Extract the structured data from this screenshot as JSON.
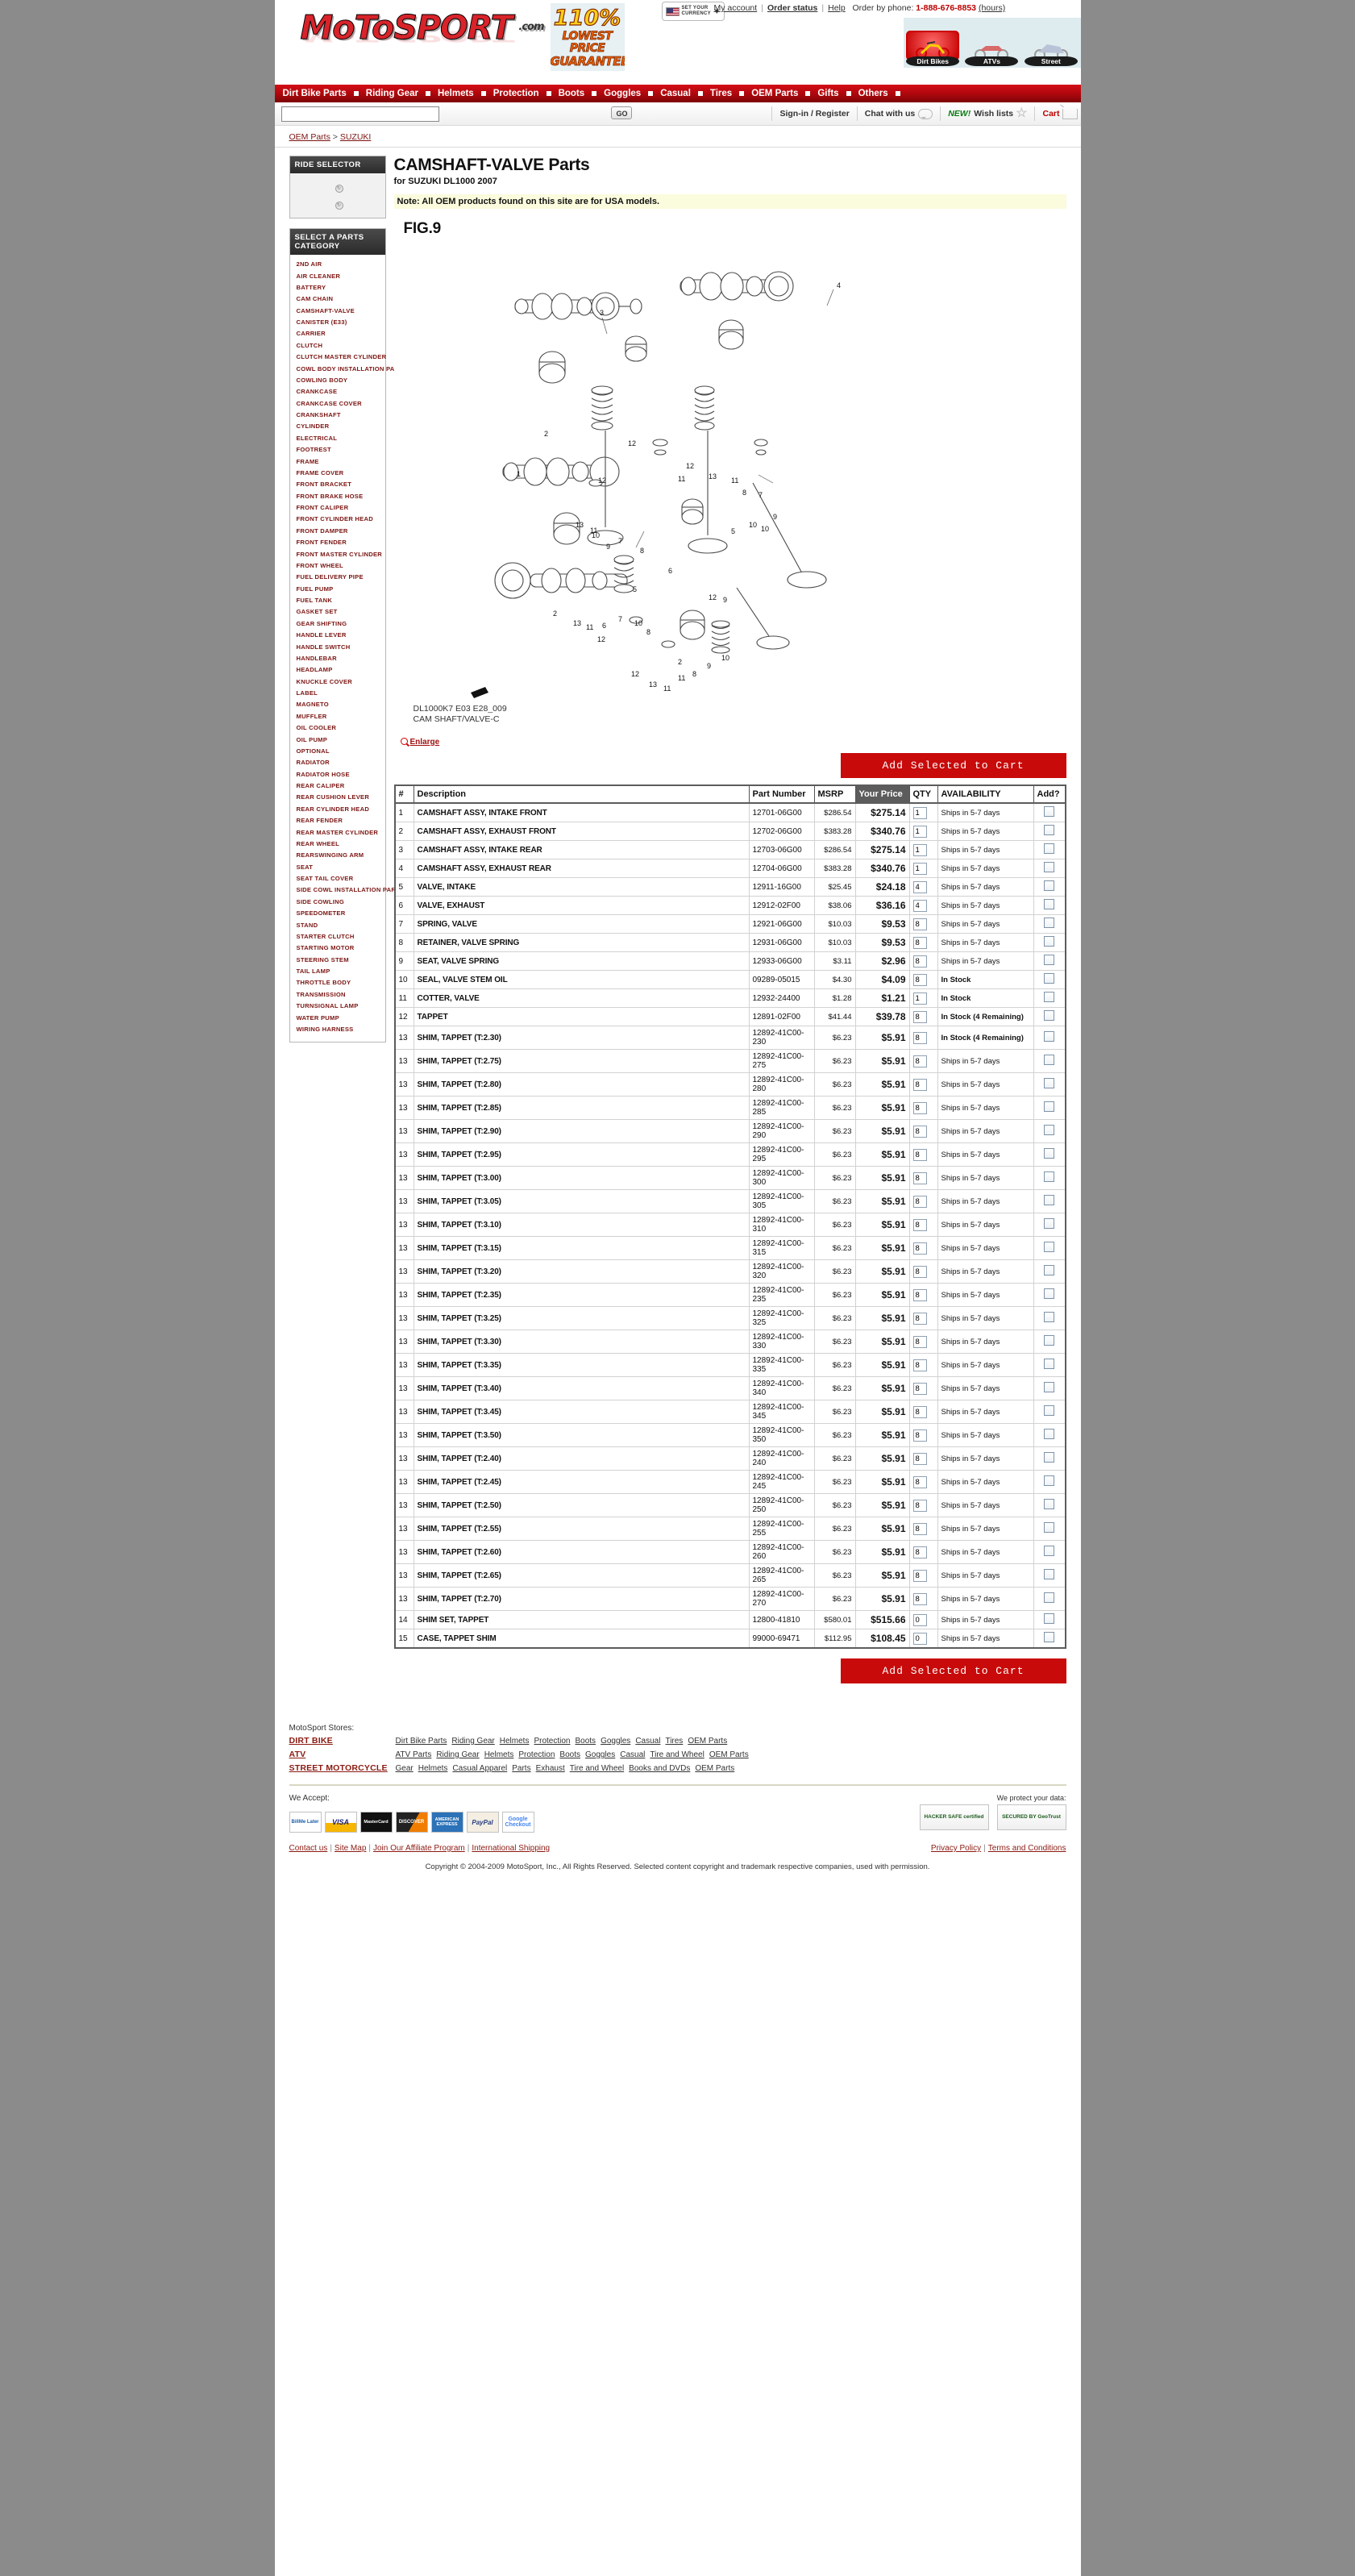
{
  "header": {
    "logo_text": "MoToSPORT",
    "logo_suffix": ".com",
    "guarantee_pct": "110%",
    "guarantee_line2": "LOWEST PRICE",
    "guarantee_line3": "GUARANTEE",
    "currency_line1": "SET YOUR",
    "currency_line2": "CURRENCY",
    "my_account": "My account",
    "order_status": "Order status",
    "help": "Help",
    "order_by_phone_label": "Order by phone:",
    "phone": "1-888-676-8853",
    "hours": "(hours)",
    "ride_tabs": [
      {
        "label": "Dirt Bikes",
        "selected": true
      },
      {
        "label": "ATVs",
        "selected": false
      },
      {
        "label": "Street",
        "selected": false
      }
    ]
  },
  "nav": {
    "items": [
      "Dirt Bike Parts",
      "Riding Gear",
      "Helmets",
      "Protection",
      "Boots",
      "Goggles",
      "Casual",
      "Tires",
      "OEM Parts",
      "Gifts",
      "Others"
    ]
  },
  "search": {
    "value": "",
    "placeholder": "",
    "go_label": "GO",
    "sign_in": "Sign-in / Register",
    "chat": "Chat with us",
    "new_tag": "NEW!",
    "wish_lists": "Wish lists",
    "cart": "Cart"
  },
  "breadcrumb": {
    "root": "OEM Parts",
    "separator": ">",
    "current": "SUZUKI"
  },
  "sidebar": {
    "ride_selector_title": "RIDE SELECTOR",
    "categories_title": "SELECT A PARTS CATEGORY",
    "categories": [
      "2ND AIR",
      "AIR CLEANER",
      "BATTERY",
      "CAM CHAIN",
      "CAMSHAFT-VALVE",
      "CANISTER (E33)",
      "CARRIER",
      "CLUTCH",
      "CLUTCH MASTER CYLINDER",
      "COWL BODY INSTALLATION PARTS",
      "COWLING BODY",
      "CRANKCASE",
      "CRANKCASE COVER",
      "CRANKSHAFT",
      "CYLINDER",
      "ELECTRICAL",
      "FOOTREST",
      "FRAME",
      "FRAME COVER",
      "FRONT BRACKET",
      "FRONT BRAKE HOSE",
      "FRONT CALIPER",
      "FRONT CYLINDER HEAD",
      "FRONT DAMPER",
      "FRONT FENDER",
      "FRONT MASTER CYLINDER",
      "FRONT WHEEL",
      "FUEL DELIVERY PIPE",
      "FUEL PUMP",
      "FUEL TANK",
      "GASKET SET",
      "GEAR SHIFTING",
      "HANDLE LEVER",
      "HANDLE SWITCH",
      "HANDLEBAR",
      "HEADLAMP",
      "KNUCKLE COVER",
      "LABEL",
      "MAGNETO",
      "MUFFLER",
      "OIL COOLER",
      "OIL PUMP",
      "OPTIONAL",
      "RADIATOR",
      "RADIATOR HOSE",
      "REAR CALIPER",
      "REAR CUSHION LEVER",
      "REAR CYLINDER HEAD",
      "REAR FENDER",
      "REAR MASTER CYLINDER",
      "REAR WHEEL",
      "REARSWINGING ARM",
      "SEAT",
      "SEAT TAIL COVER",
      "SIDE COWL INSTALLATION PARTS",
      "SIDE COWLING",
      "SPEEDOMETER",
      "STAND",
      "STARTER CLUTCH",
      "STARTING MOTOR",
      "STEERING STEM",
      "TAIL LAMP",
      "THROTTLE BODY",
      "TRANSMISSION",
      "TURNSIGNAL LAMP",
      "WATER PUMP",
      "WIRING HARNESS"
    ]
  },
  "main": {
    "title": "CAMSHAFT-VALVE Parts",
    "subtitle": "for SUZUKI DL1000 2007",
    "note": "Note: All OEM products found on this site are for USA models.",
    "fig_label": "FIG.9",
    "diagram_caption_line1": "DL1000K7 E03 E28_009",
    "diagram_caption_line2": "CAM SHAFT/VALVE-C",
    "enlarge": "Enlarge",
    "add_to_cart_top": "Add Selected to Cart",
    "add_to_cart_bottom": "Add Selected to Cart"
  },
  "table": {
    "headers": [
      "#",
      "Description",
      "Part Number",
      "MSRP",
      "Your Price",
      "QTY",
      "AVAILABILITY",
      "Add?"
    ],
    "rows": [
      {
        "n": "1",
        "desc": "CAMSHAFT ASSY, INTAKE FRONT",
        "pn": "12701-06G00",
        "msrp": "$286.54",
        "price": "$275.14",
        "qty": "1",
        "avail": "Ships in 5-7 days",
        "instock": false
      },
      {
        "n": "2",
        "desc": "CAMSHAFT ASSY, EXHAUST FRONT",
        "pn": "12702-06G00",
        "msrp": "$383.28",
        "price": "$340.76",
        "qty": "1",
        "avail": "Ships in 5-7 days",
        "instock": false
      },
      {
        "n": "3",
        "desc": "CAMSHAFT ASSY, INTAKE REAR",
        "pn": "12703-06G00",
        "msrp": "$286.54",
        "price": "$275.14",
        "qty": "1",
        "avail": "Ships in 5-7 days",
        "instock": false
      },
      {
        "n": "4",
        "desc": "CAMSHAFT ASSY, EXHAUST REAR",
        "pn": "12704-06G00",
        "msrp": "$383.28",
        "price": "$340.76",
        "qty": "1",
        "avail": "Ships in 5-7 days",
        "instock": false
      },
      {
        "n": "5",
        "desc": "VALVE, INTAKE",
        "pn": "12911-16G00",
        "msrp": "$25.45",
        "price": "$24.18",
        "qty": "4",
        "avail": "Ships in 5-7 days",
        "instock": false
      },
      {
        "n": "6",
        "desc": "VALVE, EXHAUST",
        "pn": "12912-02F00",
        "msrp": "$38.06",
        "price": "$36.16",
        "qty": "4",
        "avail": "Ships in 5-7 days",
        "instock": false
      },
      {
        "n": "7",
        "desc": "SPRING, VALVE",
        "pn": "12921-06G00",
        "msrp": "$10.03",
        "price": "$9.53",
        "qty": "8",
        "avail": "Ships in 5-7 days",
        "instock": false
      },
      {
        "n": "8",
        "desc": "RETAINER, VALVE SPRING",
        "pn": "12931-06G00",
        "msrp": "$10.03",
        "price": "$9.53",
        "qty": "8",
        "avail": "Ships in 5-7 days",
        "instock": false
      },
      {
        "n": "9",
        "desc": "SEAT, VALVE SPRING",
        "pn": "12933-06G00",
        "msrp": "$3.11",
        "price": "$2.96",
        "qty": "8",
        "avail": "Ships in 5-7 days",
        "instock": false
      },
      {
        "n": "10",
        "desc": "SEAL, VALVE STEM OIL",
        "pn": "09289-05015",
        "msrp": "$4.30",
        "price": "$4.09",
        "qty": "8",
        "avail": "In Stock",
        "instock": true
      },
      {
        "n": "11",
        "desc": "COTTER, VALVE",
        "pn": "12932-24400",
        "msrp": "$1.28",
        "price": "$1.21",
        "qty": "1",
        "avail": "In Stock",
        "instock": true
      },
      {
        "n": "12",
        "desc": "TAPPET",
        "pn": "12891-02F00",
        "msrp": "$41.44",
        "price": "$39.78",
        "qty": "8",
        "avail": "In Stock (4 Remaining)",
        "instock": true
      },
      {
        "n": "13",
        "desc": "SHIM, TAPPET (T:2.30)",
        "pn": "12892-41C00-230",
        "msrp": "$6.23",
        "price": "$5.91",
        "qty": "8",
        "avail": "In Stock (4 Remaining)",
        "instock": true
      },
      {
        "n": "13",
        "desc": "SHIM, TAPPET (T:2.75)",
        "pn": "12892-41C00-275",
        "msrp": "$6.23",
        "price": "$5.91",
        "qty": "8",
        "avail": "Ships in 5-7 days",
        "instock": false
      },
      {
        "n": "13",
        "desc": "SHIM, TAPPET (T:2.80)",
        "pn": "12892-41C00-280",
        "msrp": "$6.23",
        "price": "$5.91",
        "qty": "8",
        "avail": "Ships in 5-7 days",
        "instock": false
      },
      {
        "n": "13",
        "desc": "SHIM, TAPPET (T:2.85)",
        "pn": "12892-41C00-285",
        "msrp": "$6.23",
        "price": "$5.91",
        "qty": "8",
        "avail": "Ships in 5-7 days",
        "instock": false
      },
      {
        "n": "13",
        "desc": "SHIM, TAPPET (T:2.90)",
        "pn": "12892-41C00-290",
        "msrp": "$6.23",
        "price": "$5.91",
        "qty": "8",
        "avail": "Ships in 5-7 days",
        "instock": false
      },
      {
        "n": "13",
        "desc": "SHIM, TAPPET (T:2.95)",
        "pn": "12892-41C00-295",
        "msrp": "$6.23",
        "price": "$5.91",
        "qty": "8",
        "avail": "Ships in 5-7 days",
        "instock": false
      },
      {
        "n": "13",
        "desc": "SHIM, TAPPET (T:3.00)",
        "pn": "12892-41C00-300",
        "msrp": "$6.23",
        "price": "$5.91",
        "qty": "8",
        "avail": "Ships in 5-7 days",
        "instock": false
      },
      {
        "n": "13",
        "desc": "SHIM, TAPPET (T:3.05)",
        "pn": "12892-41C00-305",
        "msrp": "$6.23",
        "price": "$5.91",
        "qty": "8",
        "avail": "Ships in 5-7 days",
        "instock": false
      },
      {
        "n": "13",
        "desc": "SHIM, TAPPET (T:3.10)",
        "pn": "12892-41C00-310",
        "msrp": "$6.23",
        "price": "$5.91",
        "qty": "8",
        "avail": "Ships in 5-7 days",
        "instock": false
      },
      {
        "n": "13",
        "desc": "SHIM, TAPPET (T:3.15)",
        "pn": "12892-41C00-315",
        "msrp": "$6.23",
        "price": "$5.91",
        "qty": "8",
        "avail": "Ships in 5-7 days",
        "instock": false
      },
      {
        "n": "13",
        "desc": "SHIM, TAPPET (T:3.20)",
        "pn": "12892-41C00-320",
        "msrp": "$6.23",
        "price": "$5.91",
        "qty": "8",
        "avail": "Ships in 5-7 days",
        "instock": false
      },
      {
        "n": "13",
        "desc": "SHIM, TAPPET (T:2.35)",
        "pn": "12892-41C00-235",
        "msrp": "$6.23",
        "price": "$5.91",
        "qty": "8",
        "avail": "Ships in 5-7 days",
        "instock": false
      },
      {
        "n": "13",
        "desc": "SHIM, TAPPET (T:3.25)",
        "pn": "12892-41C00-325",
        "msrp": "$6.23",
        "price": "$5.91",
        "qty": "8",
        "avail": "Ships in 5-7 days",
        "instock": false
      },
      {
        "n": "13",
        "desc": "SHIM, TAPPET (T:3.30)",
        "pn": "12892-41C00-330",
        "msrp": "$6.23",
        "price": "$5.91",
        "qty": "8",
        "avail": "Ships in 5-7 days",
        "instock": false
      },
      {
        "n": "13",
        "desc": "SHIM, TAPPET (T:3.35)",
        "pn": "12892-41C00-335",
        "msrp": "$6.23",
        "price": "$5.91",
        "qty": "8",
        "avail": "Ships in 5-7 days",
        "instock": false
      },
      {
        "n": "13",
        "desc": "SHIM, TAPPET (T:3.40)",
        "pn": "12892-41C00-340",
        "msrp": "$6.23",
        "price": "$5.91",
        "qty": "8",
        "avail": "Ships in 5-7 days",
        "instock": false
      },
      {
        "n": "13",
        "desc": "SHIM, TAPPET (T:3.45)",
        "pn": "12892-41C00-345",
        "msrp": "$6.23",
        "price": "$5.91",
        "qty": "8",
        "avail": "Ships in 5-7 days",
        "instock": false
      },
      {
        "n": "13",
        "desc": "SHIM, TAPPET (T:3.50)",
        "pn": "12892-41C00-350",
        "msrp": "$6.23",
        "price": "$5.91",
        "qty": "8",
        "avail": "Ships in 5-7 days",
        "instock": false
      },
      {
        "n": "13",
        "desc": "SHIM, TAPPET (T:2.40)",
        "pn": "12892-41C00-240",
        "msrp": "$6.23",
        "price": "$5.91",
        "qty": "8",
        "avail": "Ships in 5-7 days",
        "instock": false
      },
      {
        "n": "13",
        "desc": "SHIM, TAPPET (T:2.45)",
        "pn": "12892-41C00-245",
        "msrp": "$6.23",
        "price": "$5.91",
        "qty": "8",
        "avail": "Ships in 5-7 days",
        "instock": false
      },
      {
        "n": "13",
        "desc": "SHIM, TAPPET (T:2.50)",
        "pn": "12892-41C00-250",
        "msrp": "$6.23",
        "price": "$5.91",
        "qty": "8",
        "avail": "Ships in 5-7 days",
        "instock": false
      },
      {
        "n": "13",
        "desc": "SHIM, TAPPET (T:2.55)",
        "pn": "12892-41C00-255",
        "msrp": "$6.23",
        "price": "$5.91",
        "qty": "8",
        "avail": "Ships in 5-7 days",
        "instock": false
      },
      {
        "n": "13",
        "desc": "SHIM, TAPPET (T:2.60)",
        "pn": "12892-41C00-260",
        "msrp": "$6.23",
        "price": "$5.91",
        "qty": "8",
        "avail": "Ships in 5-7 days",
        "instock": false
      },
      {
        "n": "13",
        "desc": "SHIM, TAPPET (T:2.65)",
        "pn": "12892-41C00-265",
        "msrp": "$6.23",
        "price": "$5.91",
        "qty": "8",
        "avail": "Ships in 5-7 days",
        "instock": false
      },
      {
        "n": "13",
        "desc": "SHIM, TAPPET (T:2.70)",
        "pn": "12892-41C00-270",
        "msrp": "$6.23",
        "price": "$5.91",
        "qty": "8",
        "avail": "Ships in 5-7 days",
        "instock": false
      },
      {
        "n": "14",
        "desc": "SHIM SET, TAPPET",
        "pn": "12800-41810",
        "msrp": "$580.01",
        "price": "$515.66",
        "qty": "0",
        "avail": "Ships in 5-7 days",
        "instock": false
      },
      {
        "n": "15",
        "desc": "CASE, TAPPET SHIM",
        "pn": "99000-69471",
        "msrp": "$112.95",
        "price": "$108.45",
        "qty": "0",
        "avail": "Ships in 5-7 days",
        "instock": false
      }
    ]
  },
  "footer": {
    "stores_label": "MotoSport Stores:",
    "rows": [
      {
        "cat": "DIRT BIKE",
        "links": [
          "Dirt Bike Parts",
          "Riding Gear",
          "Helmets",
          "Protection",
          "Boots",
          "Goggles",
          "Casual",
          "Tires",
          "OEM Parts"
        ]
      },
      {
        "cat": "ATV",
        "links": [
          "ATV Parts",
          "Riding Gear",
          "Helmets",
          "Protection",
          "Boots",
          "Goggles",
          "Casual",
          "Tire and Wheel",
          "OEM Parts"
        ]
      },
      {
        "cat": "STREET MOTORCYCLE",
        "links": [
          "Gear",
          "Helmets",
          "Casual Apparel",
          "Parts",
          "Exhaust",
          "Tire and Wheel",
          "Books and DVDs",
          "OEM Parts"
        ]
      }
    ],
    "we_accept": "We Accept:",
    "cards": [
      "BillMe Later",
      "VISA",
      "MasterCard",
      "DISCOVER",
      "AMERICAN EXPRESS",
      "PayPal",
      "Google Checkout"
    ],
    "protect_label": "We protect your data:",
    "badges": [
      "HACKER SAFE certified",
      "SECURED BY GeoTrust"
    ],
    "bottom_links": [
      "Contact us",
      "Site Map",
      "Join Our Affiliate Program",
      "International Shipping"
    ],
    "privacy_links": [
      "Privacy Policy",
      "Terms and Conditions"
    ],
    "copyright": "Copyright © 2004-2009 MotoSport, Inc., All Rights Reserved. Selected content copyright and trademark respective companies, used with permission."
  }
}
